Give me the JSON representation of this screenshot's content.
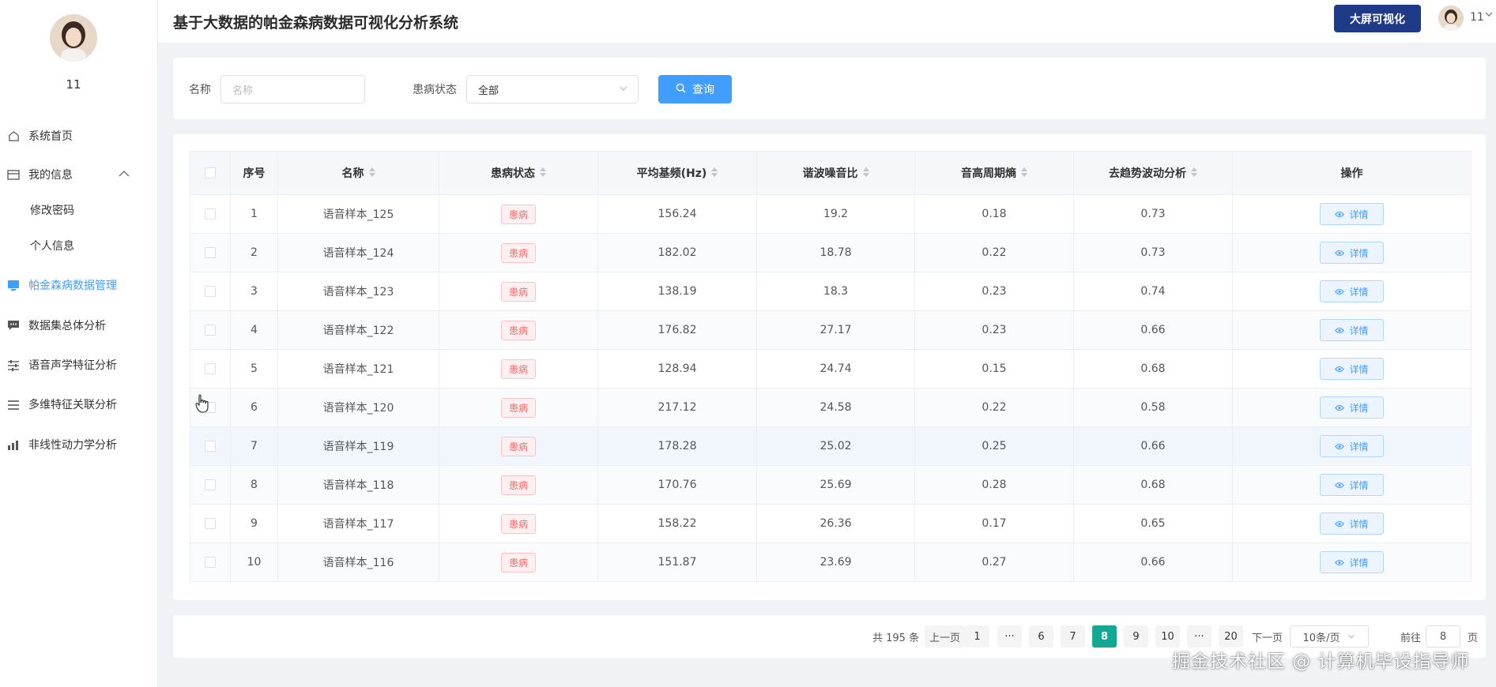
{
  "app": {
    "title": "基于大数据的帕金森病数据可视化分析系统",
    "big_screen_label": "大屏可视化",
    "user": "11"
  },
  "sidebar": {
    "username": "11",
    "items": [
      {
        "label": "系统首页",
        "icon": "home-icon"
      },
      {
        "label": "我的信息",
        "icon": "card-icon"
      },
      {
        "label": "修改密码",
        "icon": ""
      },
      {
        "label": "个人信息",
        "icon": ""
      },
      {
        "label": "帕金森病数据管理",
        "icon": "monitor-icon"
      },
      {
        "label": "数据集总体分析",
        "icon": "chat-icon"
      },
      {
        "label": "语音声学特征分析",
        "icon": "sliders-icon"
      },
      {
        "label": "多维特征关联分析",
        "icon": "list-icon"
      },
      {
        "label": "非线性动力学分析",
        "icon": "chart-icon"
      }
    ],
    "active_color": "#409eff"
  },
  "search": {
    "name_label": "名称",
    "name_placeholder": "名称",
    "status_label": "患病状态",
    "status_value": "全部",
    "button_label": "查询"
  },
  "table": {
    "columns": [
      "序号",
      "名称",
      "患病状态",
      "平均基频(Hz)",
      "谐波噪音比",
      "音高周期熵",
      "去趋势波动分析",
      "操作"
    ],
    "detail_label": "详情",
    "rows": [
      {
        "idx": "1",
        "name": "语音样本_125",
        "status": "患病",
        "f0": "156.24",
        "hnr": "19.2",
        "ppe": "0.18",
        "dfa": "0.73"
      },
      {
        "idx": "2",
        "name": "语音样本_124",
        "status": "患病",
        "f0": "182.02",
        "hnr": "18.78",
        "ppe": "0.22",
        "dfa": "0.73"
      },
      {
        "idx": "3",
        "name": "语音样本_123",
        "status": "患病",
        "f0": "138.19",
        "hnr": "18.3",
        "ppe": "0.23",
        "dfa": "0.74"
      },
      {
        "idx": "4",
        "name": "语音样本_122",
        "status": "患病",
        "f0": "176.82",
        "hnr": "27.17",
        "ppe": "0.23",
        "dfa": "0.66"
      },
      {
        "idx": "5",
        "name": "语音样本_121",
        "status": "患病",
        "f0": "128.94",
        "hnr": "24.74",
        "ppe": "0.15",
        "dfa": "0.68"
      },
      {
        "idx": "6",
        "name": "语音样本_120",
        "status": "患病",
        "f0": "217.12",
        "hnr": "24.58",
        "ppe": "0.22",
        "dfa": "0.58"
      },
      {
        "idx": "7",
        "name": "语音样本_119",
        "status": "患病",
        "f0": "178.28",
        "hnr": "25.02",
        "ppe": "0.25",
        "dfa": "0.66"
      },
      {
        "idx": "8",
        "name": "语音样本_118",
        "status": "患病",
        "f0": "170.76",
        "hnr": "25.69",
        "ppe": "0.28",
        "dfa": "0.68"
      },
      {
        "idx": "9",
        "name": "语音样本_117",
        "status": "患病",
        "f0": "158.22",
        "hnr": "26.36",
        "ppe": "0.17",
        "dfa": "0.65"
      },
      {
        "idx": "10",
        "name": "语音样本_116",
        "status": "患病",
        "f0": "151.87",
        "hnr": "23.69",
        "ppe": "0.27",
        "dfa": "0.66"
      }
    ]
  },
  "pagination": {
    "total": "共 195 条",
    "prev": "上一页",
    "next": "下一页",
    "pages": [
      "1",
      "···",
      "6",
      "7",
      "8",
      "9",
      "10",
      "···",
      "20"
    ],
    "current": "8",
    "page_size": "10条/页",
    "goto_label": "前往",
    "goto_value": "8",
    "goto_unit": "页",
    "active_color": "#13a893"
  },
  "watermark": "掘金技术社区 @ 计算机毕设指导师"
}
